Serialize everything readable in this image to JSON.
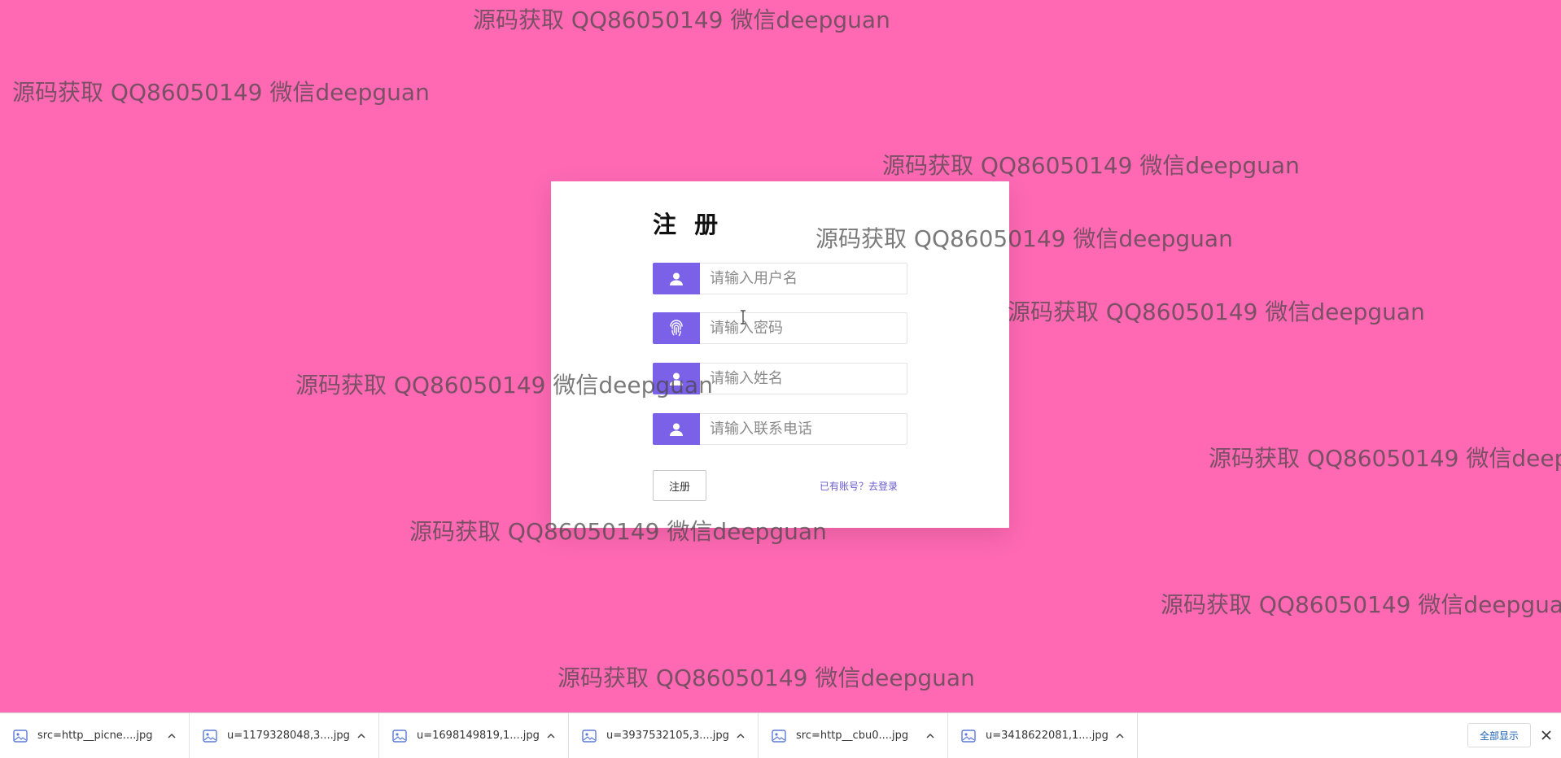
{
  "watermark_text": "源码获取 QQ86050149 微信deepguan",
  "register": {
    "title": "注 册",
    "fields": [
      {
        "placeholder": "请输入用户名",
        "icon": "user-icon"
      },
      {
        "placeholder": "请输入密码",
        "icon": "fingerprint-icon"
      },
      {
        "placeholder": "请输入姓名",
        "icon": "user-icon"
      },
      {
        "placeholder": "请输入联系电话",
        "icon": "user-icon"
      }
    ],
    "submit_label": "注册",
    "login_link": "已有账号？去登录"
  },
  "downloads": {
    "items": [
      {
        "name": "src=http__picne....jpg"
      },
      {
        "name": "u=1179328048,3....jpg"
      },
      {
        "name": "u=1698149819,1....jpg"
      },
      {
        "name": "u=3937532105,3....jpg"
      },
      {
        "name": "src=http__cbu0....jpg"
      },
      {
        "name": "u=3418622081,1....jpg"
      }
    ],
    "show_all_label": "全部显示"
  },
  "colors": {
    "background": "#ff69b4",
    "accent": "#7b61e8",
    "link": "#6a5acd"
  }
}
